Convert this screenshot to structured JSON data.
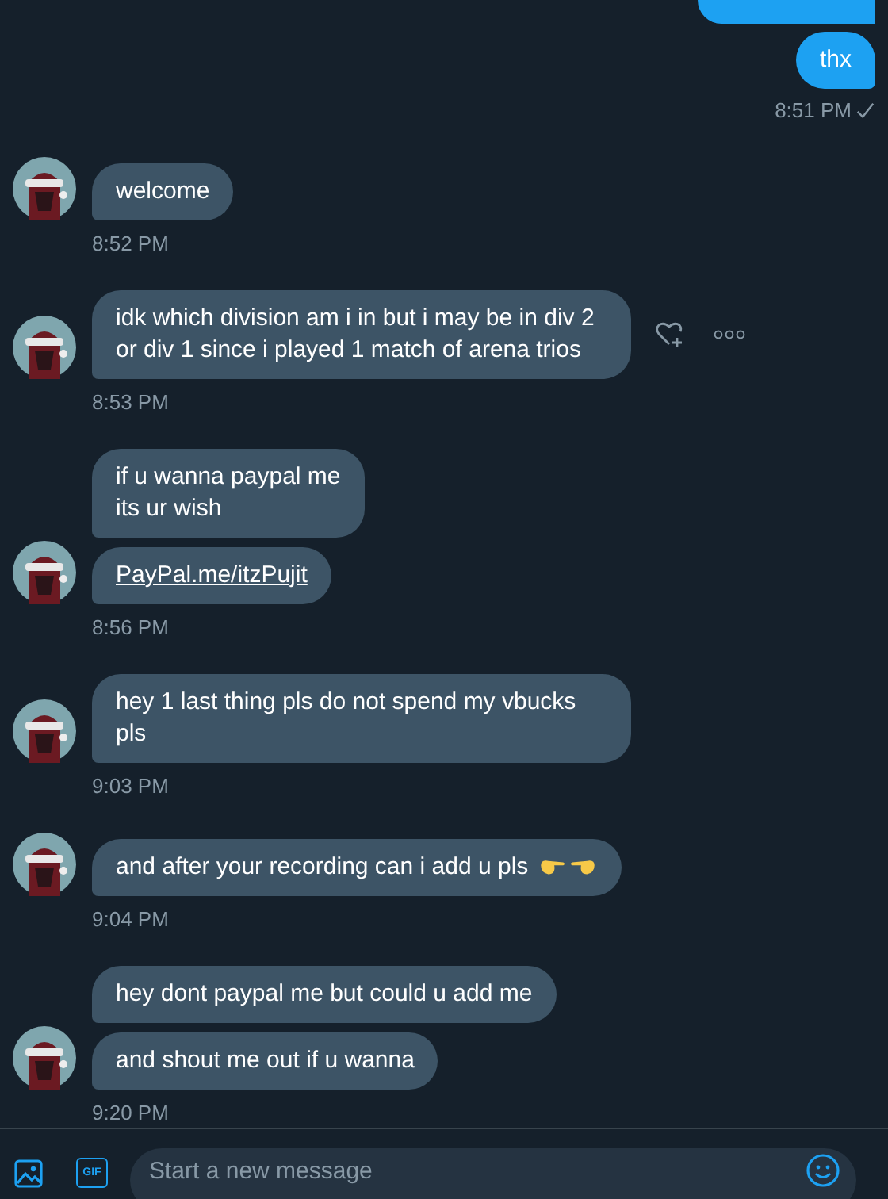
{
  "outgoing": {
    "messages": [
      "thx"
    ],
    "time": "8:51 PM",
    "read": true
  },
  "incoming": [
    {
      "messages": [
        {
          "kind": "text",
          "text": "welcome"
        }
      ],
      "time": "8:52 PM"
    },
    {
      "messages": [
        {
          "kind": "text",
          "text": "idk which division am i in but i may be in div 2 or div 1 since i played 1 match of arena trios",
          "hover_actions": true
        }
      ],
      "time": "8:53 PM"
    },
    {
      "messages": [
        {
          "kind": "text",
          "text": "if u wanna paypal me\nits ur wish"
        },
        {
          "kind": "link",
          "text": "PayPal.me/itzPujit"
        }
      ],
      "time": "8:56 PM"
    },
    {
      "messages": [
        {
          "kind": "text",
          "text": "hey 1 last thing pls do not spend my vbucks pls"
        }
      ],
      "time": "9:03 PM"
    },
    {
      "messages": [
        {
          "kind": "text",
          "text": "and after your recording can i add u pls",
          "pointing_emoji": true
        }
      ],
      "time": "9:04 PM"
    },
    {
      "messages": [
        {
          "kind": "text",
          "text": "hey dont paypal me but could u add me"
        },
        {
          "kind": "text",
          "text": "and shout me out if u wanna"
        }
      ],
      "time": "9:20 PM"
    }
  ],
  "composer": {
    "gif_label": "GIF",
    "placeholder": "Start a new message"
  }
}
